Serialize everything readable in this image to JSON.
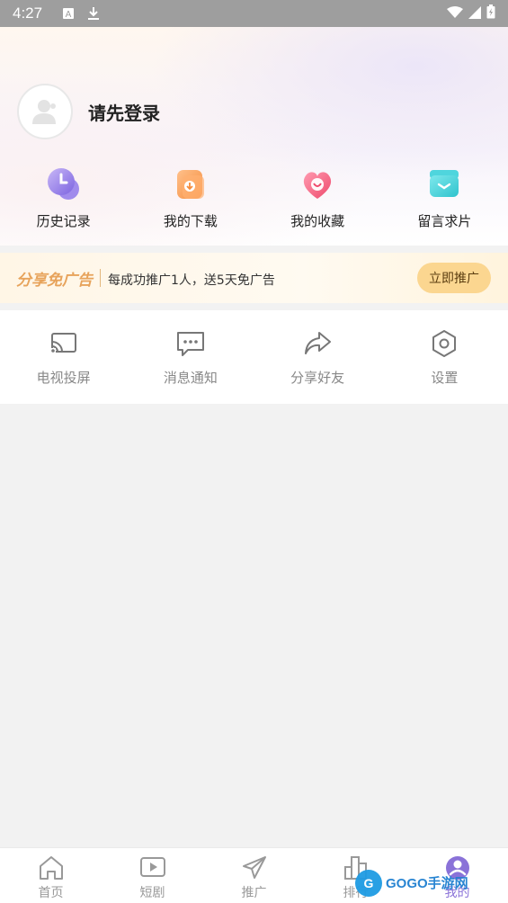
{
  "status_bar": {
    "time": "4:27"
  },
  "profile": {
    "login_prompt": "请先登录"
  },
  "quick_actions": [
    {
      "label": "历史记录",
      "icon": "clock-icon"
    },
    {
      "label": "我的下载",
      "icon": "download-icon"
    },
    {
      "label": "我的收藏",
      "icon": "heart-icon"
    },
    {
      "label": "留言求片",
      "icon": "message-box-icon"
    }
  ],
  "promo": {
    "title": "分享免广告",
    "description": "每成功推广1人，送5天免广告",
    "button": "立即推广"
  },
  "tools": [
    {
      "label": "电视投屏",
      "icon": "cast-icon"
    },
    {
      "label": "消息通知",
      "icon": "chat-bubble-icon"
    },
    {
      "label": "分享好友",
      "icon": "share-arrow-icon"
    },
    {
      "label": "设置",
      "icon": "hexagon-settings-icon"
    }
  ],
  "bottom_nav": [
    {
      "label": "首页",
      "icon": "home-icon"
    },
    {
      "label": "短剧",
      "icon": "play-box-icon"
    },
    {
      "label": "推广",
      "icon": "paper-plane-icon"
    },
    {
      "label": "排行",
      "icon": "bar-chart-icon"
    },
    {
      "label": "我的",
      "icon": "profile-icon",
      "active": true
    }
  ],
  "watermark": {
    "text": "GOGO手游网"
  },
  "colors": {
    "accent": "#8a72d8",
    "promo_button": "#fbd690",
    "promo_title": "#e7a35b"
  }
}
